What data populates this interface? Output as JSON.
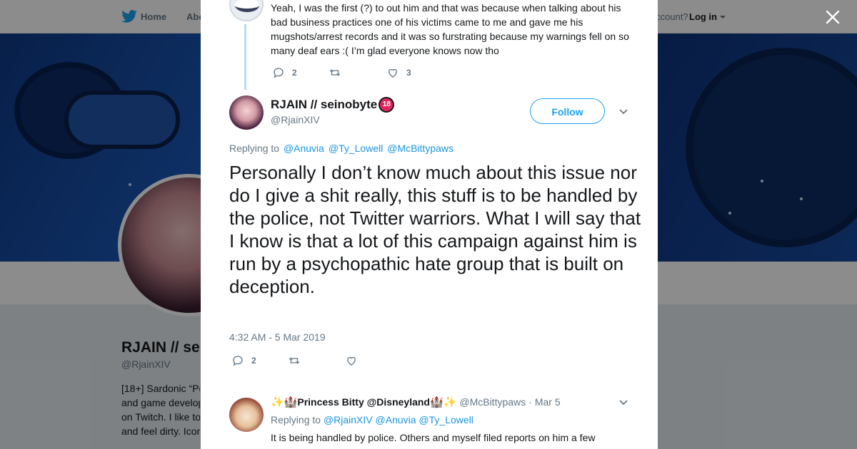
{
  "nav": {
    "home_label": "Home",
    "about_label": "Abo",
    "account_prompt": "ccount?",
    "login_label": "Log in"
  },
  "profile_bg": {
    "name": "RJAIN // se",
    "handle": "@RjainXIV",
    "bio_lines": [
      "[18+] Sardonic “Po",
      "and game develop",
      "on Twitch. I like to",
      "and feel dirty. Icon"
    ]
  },
  "previous_tweet": {
    "text": "Yeah, I was the first (?) to out him and that was because when talking about his bad business practices one of his victims came to me and gave me his mugshots/arrest records and it was so furstrating because my warnings fell on so many deaf ears :( I’m glad everyone knows now tho",
    "reply_count": "2",
    "like_count": "3"
  },
  "main_tweet": {
    "display_name": "RJAIN // seinobyte",
    "badge_text": "18",
    "handle": "@RjainXIV",
    "follow_label": "Follow",
    "replying_label": "Replying to",
    "replying_to": [
      "@Anuvia",
      "@Ty_Lowell",
      "@McBittypaws"
    ],
    "text": "Personally I don’t know much about this issue nor do I give a shit really, this stuff is to be handled by the police, not Twitter warriors. What I will say that I know is that a lot of this campaign against him is run by a psychopathic hate group that is built on deception.",
    "timestamp": "4:32 AM - 5 Mar 2019",
    "reply_count": "2"
  },
  "reply_tweet": {
    "display_name": "Princess Bitty @Disneyland",
    "handle": "@McBittypaws",
    "separator": "·",
    "date": "Mar 5",
    "replying_label": "Replying to",
    "replying_to": [
      "@RjainXIV",
      "@Anuvia",
      "@Ty_Lowell"
    ],
    "text": "It is being handled by police. Others and myself filed reports on him a few"
  },
  "colors": {
    "link": "#1b95e0",
    "muted": "#657786",
    "follow": "#1da1f2"
  },
  "icons": [
    "twitter-bird-icon",
    "close-icon",
    "reply-icon",
    "retweet-icon",
    "like-icon",
    "chevron-down-icon",
    "sparkles-icon",
    "castle-icon"
  ]
}
